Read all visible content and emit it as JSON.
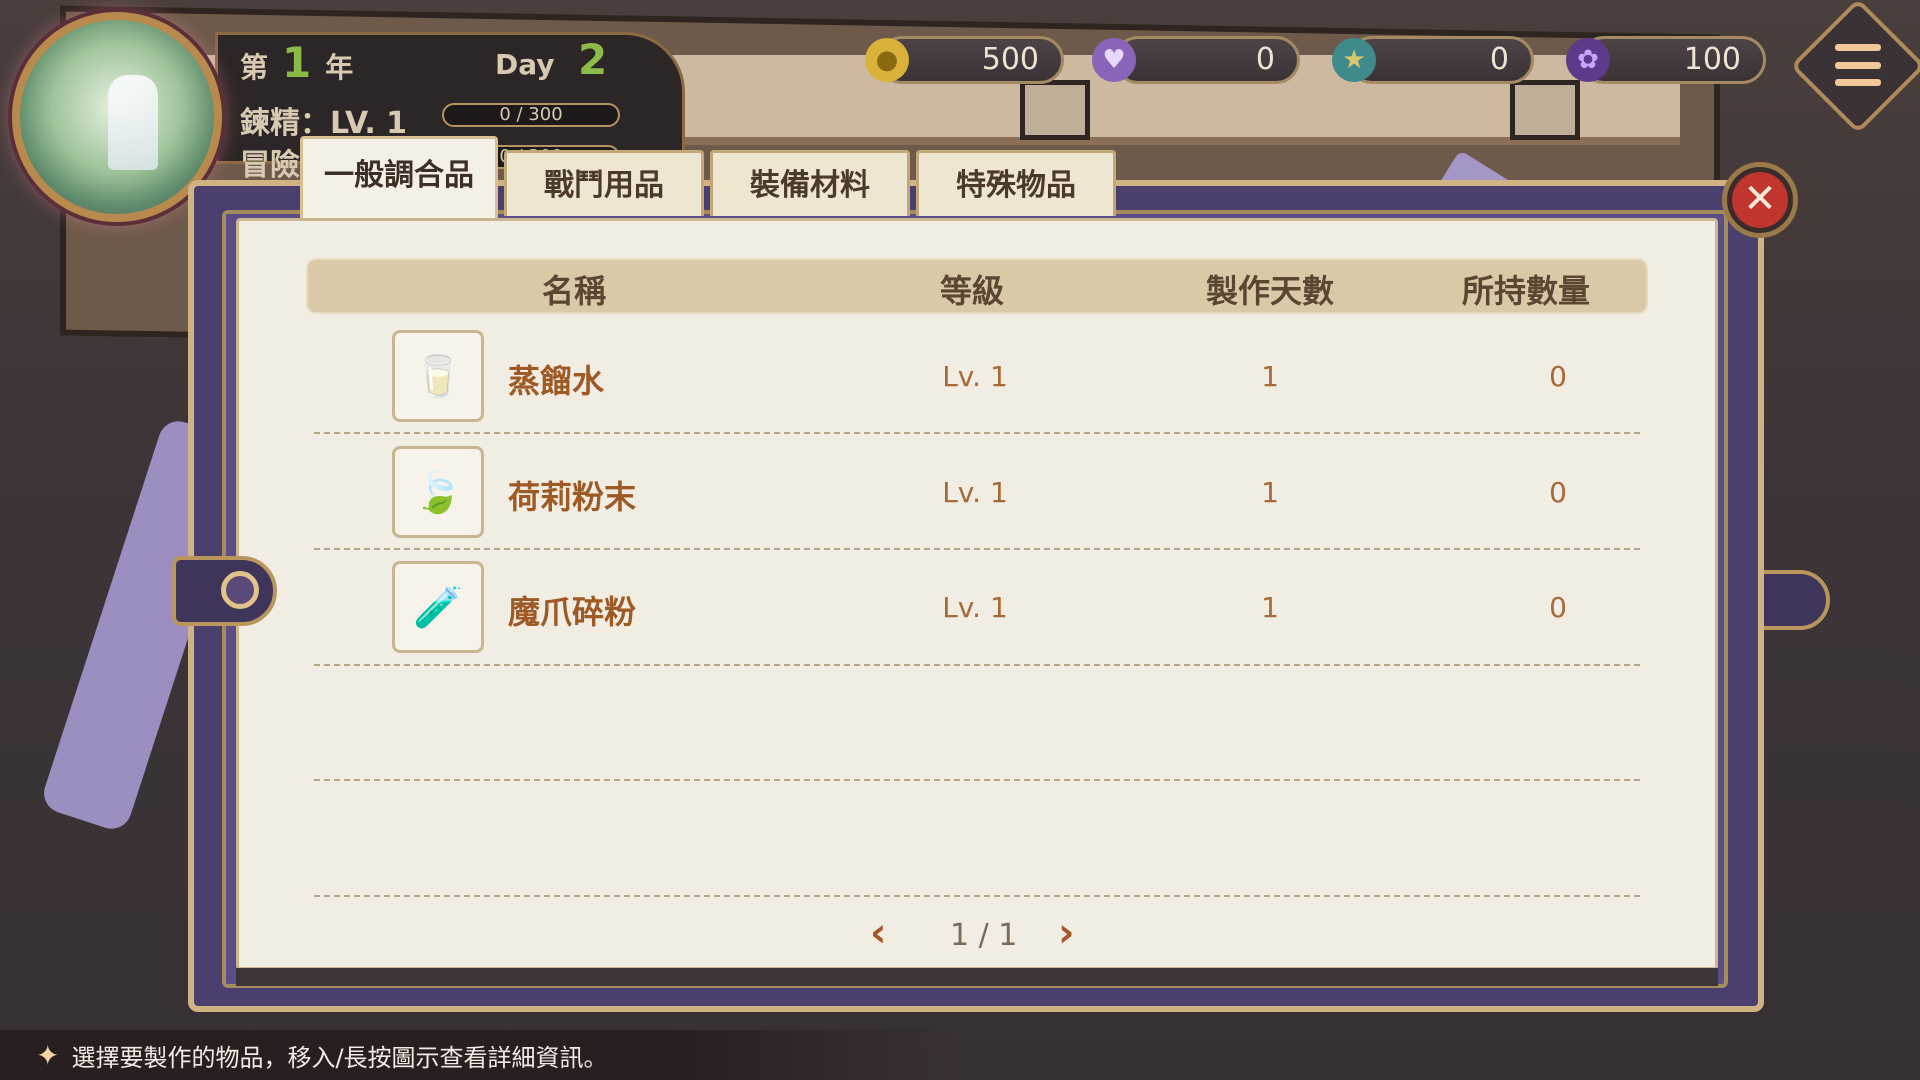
{
  "status": {
    "year_prefix": "第",
    "year_value": "1",
    "year_suffix": "年",
    "day_label": "Day",
    "day_value": "2",
    "refine_label": "鍊精：LV. 1",
    "refine_progress": "0 / 300",
    "adventure_label": "冒險",
    "adventure_progress": "0 / 300"
  },
  "currencies": [
    {
      "icon": "gold-coin-icon",
      "value": "500"
    },
    {
      "icon": "purple-heart-icon",
      "value": "0"
    },
    {
      "icon": "star-gem-icon",
      "value": "0"
    },
    {
      "icon": "purple-flower-icon",
      "value": "100"
    }
  ],
  "tabs": [
    {
      "label": "一般調合品",
      "active": true
    },
    {
      "label": "戰鬥用品",
      "active": false
    },
    {
      "label": "裝備材料",
      "active": false
    },
    {
      "label": "特殊物品",
      "active": false
    }
  ],
  "table": {
    "headers": [
      "名稱",
      "等級",
      "製作天數",
      "所持數量"
    ],
    "rows": [
      {
        "icon": "water-glass-icon",
        "name": "蒸餾水",
        "level": "Lv. 1",
        "days": "1",
        "owned": "0"
      },
      {
        "icon": "jasmine-powder-icon",
        "name": "荷莉粉末",
        "level": "Lv. 1",
        "days": "1",
        "owned": "0"
      },
      {
        "icon": "potion-bottle-icon",
        "name": "魔爪碎粉",
        "level": "Lv. 1",
        "days": "1",
        "owned": "0"
      }
    ]
  },
  "pager": {
    "text": "1 / 1"
  },
  "hint": {
    "text": "選擇要製作的物品，移入/長按圖示查看詳細資訊。"
  },
  "colors": {
    "accent_purple": "#4a3f6e",
    "paper": "#f2ede3",
    "item_name": "#9d5a24",
    "close_red": "#c0362f"
  }
}
